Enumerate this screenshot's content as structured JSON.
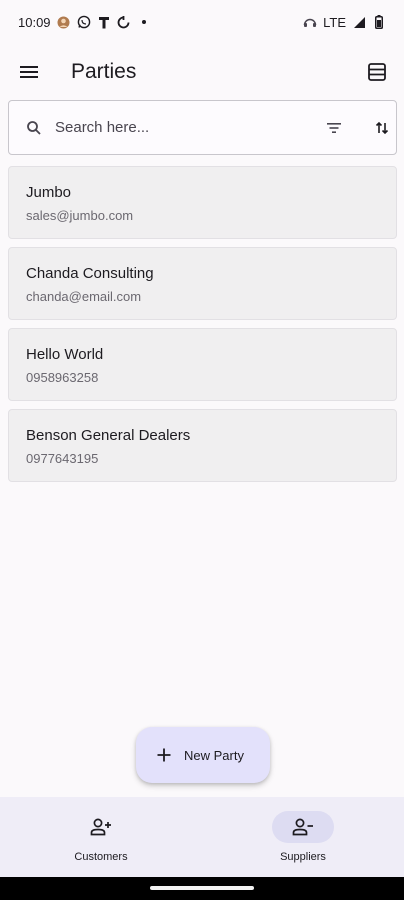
{
  "status_bar": {
    "time": "10:09",
    "network": "LTE",
    "icons": [
      "avatar-icon",
      "whatsapp-icon",
      "t-icon",
      "sync-icon",
      "dot-icon",
      "headset-icon",
      "signal-icon",
      "battery-icon"
    ]
  },
  "app_bar": {
    "title": "Parties",
    "menu_icon": "menu-icon",
    "view_icon": "table-view-icon"
  },
  "search": {
    "placeholder": "Search here...",
    "value": ""
  },
  "parties": [
    {
      "name": "Jumbo",
      "detail": "sales@jumbo.com"
    },
    {
      "name": "Chanda Consulting",
      "detail": "chanda@email.com"
    },
    {
      "name": "Hello World",
      "detail": "0958963258"
    },
    {
      "name": "Benson General Dealers",
      "detail": "0977643195"
    }
  ],
  "fab": {
    "label": "New Party"
  },
  "bottom_nav": {
    "items": [
      {
        "label": "Customers",
        "icon": "person-add-icon",
        "active": false
      },
      {
        "label": "Suppliers",
        "icon": "person-remove-icon",
        "active": true
      }
    ]
  },
  "colors": {
    "background": "#fbf9fb",
    "card": "#f0eff0",
    "fab": "#e3e1fb",
    "nav_bg": "#efedf7",
    "nav_active": "#dddcf2"
  }
}
